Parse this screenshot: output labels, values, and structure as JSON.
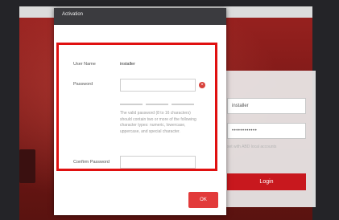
{
  "colors": {
    "accent": "#e23a3a",
    "highlight": "#e01010",
    "dialog_header": "#3b3b3f"
  },
  "dialog": {
    "title": "Activation",
    "user_name_label": "User Name",
    "user_name_value": "installer",
    "password_label": "Password",
    "password_value": "",
    "hint": "The valid password (8 to 16 characters) should contain two or more of the following character types: numeric, lowercase, uppercase, and special character.",
    "confirm_label": "Confirm Password",
    "confirm_value": "",
    "ok_label": "OK"
  },
  "login": {
    "username": "installer",
    "password_mask": "••••••••••••",
    "remember_hint": "set with ABD local accounts",
    "login_label": "Login"
  },
  "icons": {
    "clear": "clear-icon"
  }
}
